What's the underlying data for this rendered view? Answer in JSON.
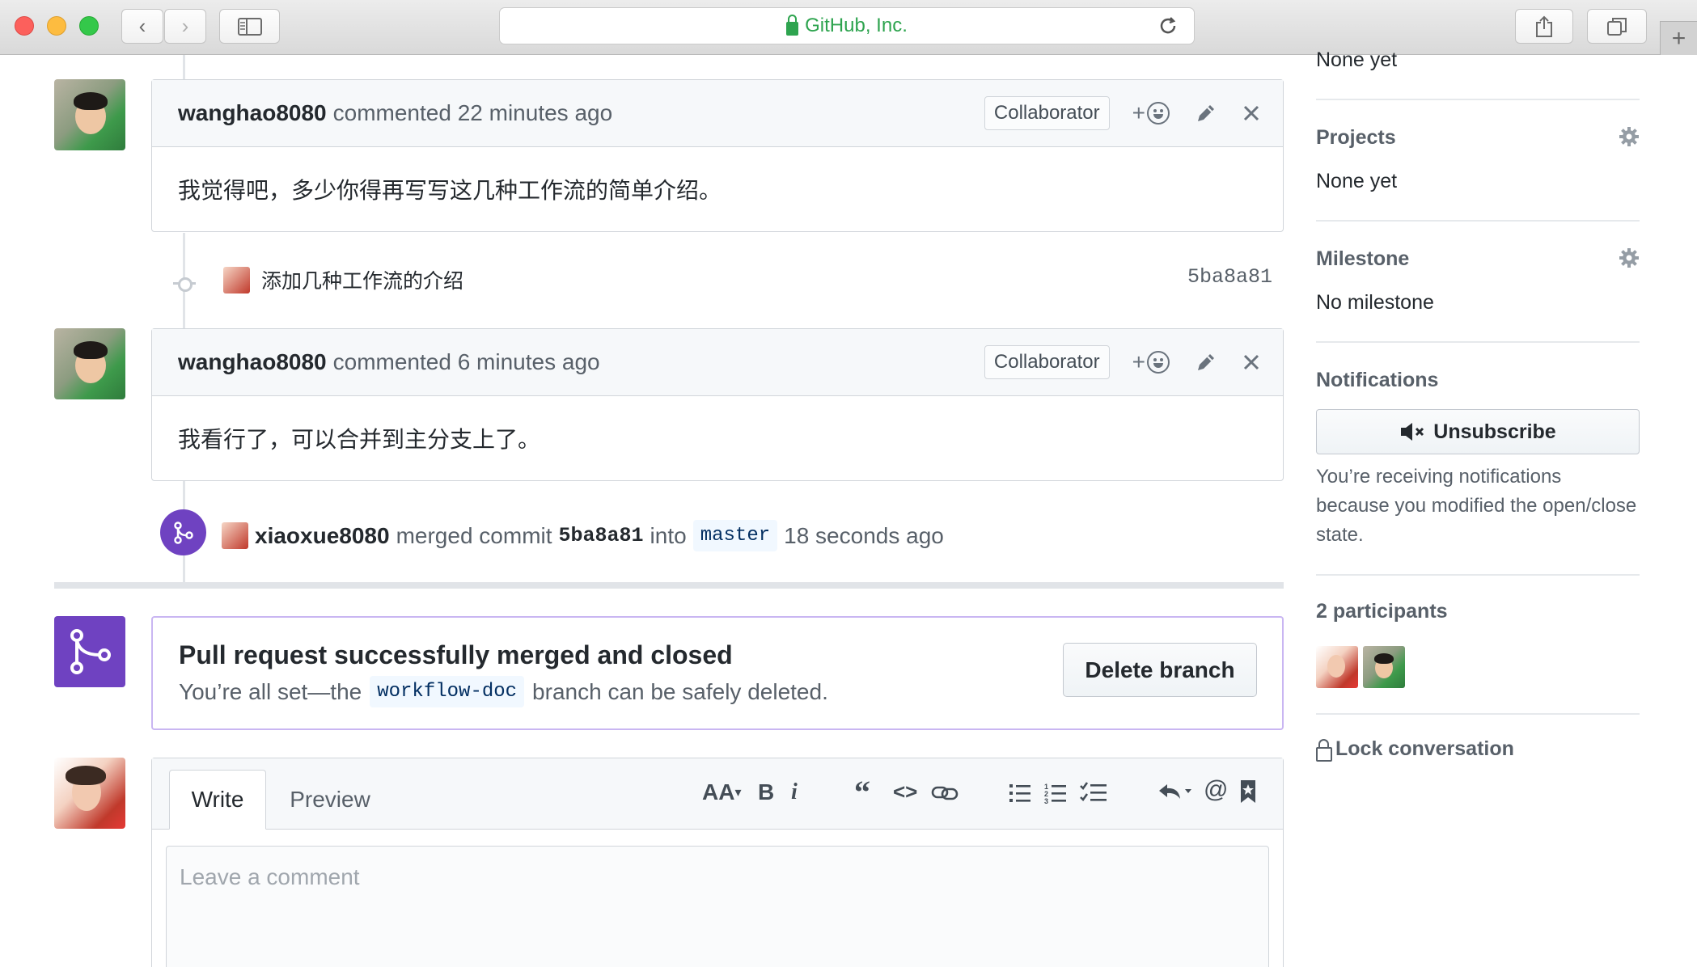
{
  "browser": {
    "address_text": "GitHub, Inc.",
    "nav_back": "‹",
    "nav_forward": "›"
  },
  "timeline": {
    "comments": [
      {
        "author": "wanghao8080",
        "action": "commented 22 minutes ago",
        "badge": "Collaborator",
        "body": "我觉得吧，多少你得再写写这几种工作流的简单介绍。"
      },
      {
        "author": "wanghao8080",
        "action": "commented 6 minutes ago",
        "badge": "Collaborator",
        "body": "我看行了，可以合并到主分支上了。"
      }
    ],
    "commit": {
      "message": "添加几种工作流的介绍",
      "sha": "5ba8a81"
    },
    "merge_event": {
      "actor": "xiaoxue8080",
      "text_merged": "merged commit",
      "sha": "5ba8a81",
      "text_into": "into",
      "branch": "master",
      "time": "18 seconds ago"
    }
  },
  "merged_box": {
    "title": "Pull request successfully merged and closed",
    "sub_before": "You’re all set—the",
    "branch": "workflow-doc",
    "sub_after": "branch can be safely deleted.",
    "delete_button": "Delete branch"
  },
  "editor": {
    "tab_write": "Write",
    "tab_preview": "Preview",
    "placeholder": "Leave a comment",
    "toolbar": {
      "header": "AA",
      "bold": "B",
      "italic": "i",
      "quote": "“",
      "code": "<>"
    }
  },
  "sidebar": {
    "top_cut_value": "None yet",
    "projects": {
      "title": "Projects",
      "value": "None yet"
    },
    "milestone": {
      "title": "Milestone",
      "value": "No milestone"
    },
    "notifications": {
      "title": "Notifications",
      "button": "Unsubscribe",
      "reason": "You’re receiving notifications because you modified the open/close state."
    },
    "participants": {
      "title": "2 participants"
    },
    "lock": "Lock conversation"
  },
  "colors": {
    "merged_purple": "#6f42c1",
    "link_green": "#2ea44f"
  }
}
